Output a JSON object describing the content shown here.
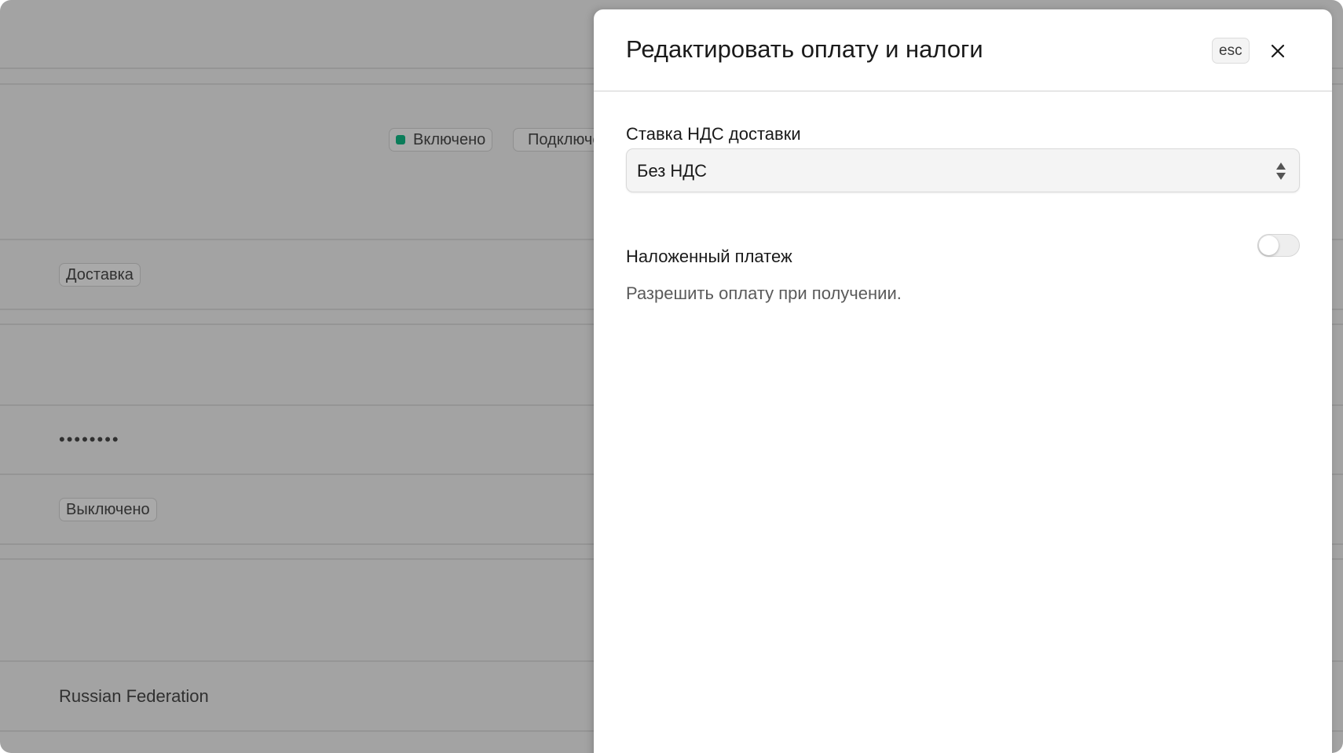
{
  "background_page": {
    "status_badge_on": "Включено",
    "status_badge_connected": "Подключено",
    "delivery_badge": "Доставка",
    "password_mask": "••••••••",
    "off_badge": "Выключено",
    "country": "Russian Federation",
    "accent_dot_color": "#0b7d5a"
  },
  "drawer": {
    "title": "Редактировать оплату и налоги",
    "esc_label": "esc",
    "close_icon": "close-icon",
    "vat_field": {
      "label": "Ставка НДС доставки",
      "selected_value": "Без НДС"
    },
    "cod": {
      "label": "Наложенный платеж",
      "description": "Разрешить оплату при получении.",
      "enabled": false
    }
  }
}
